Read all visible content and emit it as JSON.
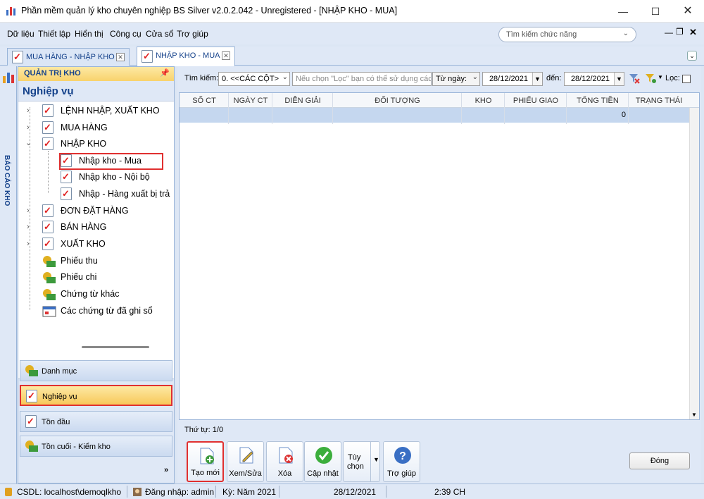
{
  "window": {
    "title": "Phần mềm quản lý kho chuyên nghiệp BS Silver v2.0.2.042 - Unregistered - [NHẬP KHO - MUA]"
  },
  "menu": [
    "Dữ liệu",
    "Thiết lập",
    "Hiển thị",
    "Công cụ",
    "Cửa sổ",
    "Trợ giúp"
  ],
  "search": {
    "placeholder": "Tìm kiếm chức năng"
  },
  "tabs": [
    "MUA HÀNG - NHẬP KHO",
    "NHẬP KHO - MUA"
  ],
  "sidebar": {
    "vertical_label": "BÁO CÁO KHO",
    "header": "QUẢN TRỊ KHO",
    "title": "Nghiệp vụ",
    "tree": [
      "LỆNH NHẬP, XUẤT KHO",
      "MUA HÀNG",
      "NHẬP KHO",
      "Nhập kho - Mua",
      "Nhập kho - Nội bộ",
      "Nhập - Hàng xuất bị trả",
      "ĐƠN ĐẶT HÀNG",
      "BÁN HÀNG",
      "XUẤT KHO",
      "Phiếu thu",
      "Phiếu chi",
      "Chứng từ khác",
      "Các chứng từ đã ghi sổ"
    ],
    "nav_buttons": [
      "Danh mục",
      "Nghiệp vụ",
      "Tồn đầu",
      "Tồn cuối - Kiểm kho"
    ]
  },
  "filter": {
    "search_label": "Tìm kiếm:",
    "column_value": "0. <<CÁC CỘT>",
    "hint": "Nếu chọn \"Lọc\" bạn có thể sử dụng các ký",
    "from_label": "Từ ngày:",
    "from_date": "28/12/2021",
    "to_label": "đến:",
    "to_date": "28/12/2021",
    "filter_label": "Lọc:"
  },
  "grid": {
    "columns": [
      "SỐ CT",
      "NGÀY CT",
      "DIỄN GIẢI",
      "ĐỐI TƯỢNG",
      "KHO",
      "PHIẾU GIAO",
      "TỔNG TIỀN",
      "TRẠNG THÁI"
    ],
    "total_value": "0"
  },
  "order_text": "Thứ tự: 1/0",
  "toolbar": {
    "new": "Tạo mới",
    "edit": "Xem/Sửa",
    "delete": "Xóa",
    "update": "Cập nhật",
    "options_1": "Tùy",
    "options_2": "chọn",
    "help": "Trợ giúp",
    "close": "Đóng"
  },
  "statusbar": {
    "db": "CSDL: localhost\\demoqlkho",
    "login": "Đăng nhập: admin",
    "period": "Kỳ: Năm 2021",
    "date": "28/12/2021",
    "time": "2:39 CH"
  },
  "colors": {
    "accent": "#15428b",
    "highlight": "#e03030",
    "selected_row": "#c5d7ef"
  }
}
